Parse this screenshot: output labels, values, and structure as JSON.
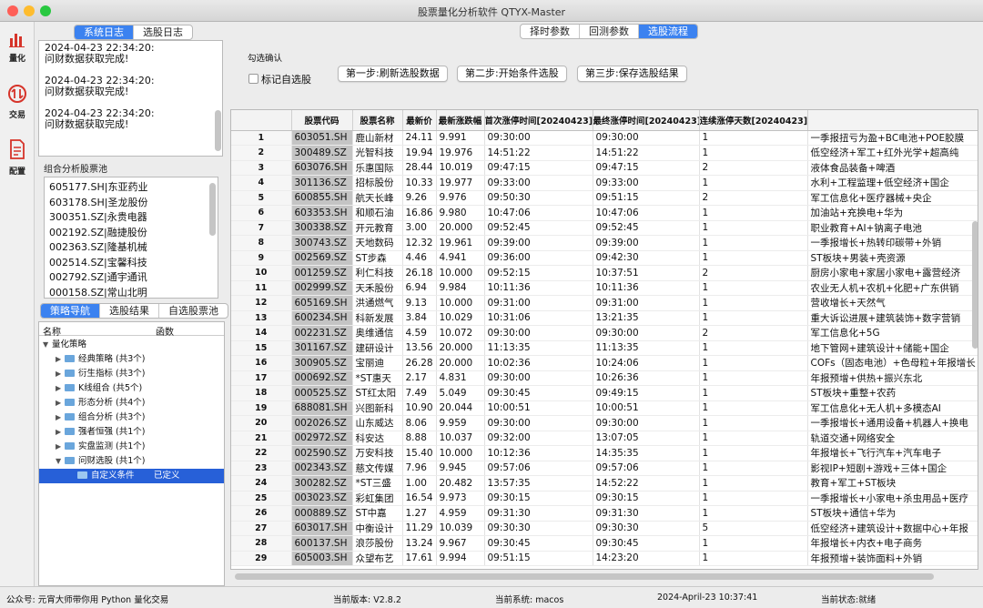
{
  "window": {
    "title": "股票量化分析软件 QTYX-Master"
  },
  "sidebar": {
    "items": [
      {
        "label": "量化",
        "icon": "bar-chart-icon"
      },
      {
        "label": "交易",
        "icon": "exchange-icon"
      },
      {
        "label": "配置",
        "icon": "document-icon"
      }
    ]
  },
  "left_tabs": {
    "tab1": "系统日志",
    "tab2": "选股日志"
  },
  "log": {
    "entries": [
      {
        "time": "2024-04-23 22:34:20:",
        "msg": "问财数据获取完成!"
      },
      {
        "time": "2024-04-23 22:34:20:",
        "msg": "问财数据获取完成!"
      },
      {
        "time": "2024-04-23 22:34:20:",
        "msg": "问财数据获取完成!"
      }
    ]
  },
  "pool": {
    "caption": "组合分析股票池",
    "items": [
      "605177.SH|东亚药业",
      "603178.SH|圣龙股份",
      "300351.SZ|永贵电器",
      "002192.SZ|融捷股份",
      "002363.SZ|隆基机械",
      "002514.SZ|宝馨科技",
      "002792.SZ|通宇通讯",
      "000158.SZ|常山北明"
    ]
  },
  "strategy_tabs": {
    "tab1": "策略导航",
    "tab2": "选股结果",
    "tab3": "自选股票池"
  },
  "tree": {
    "col_name": "名称",
    "col_func": "函数",
    "root": "量化策略",
    "nodes": [
      "经典策略 (共3个)",
      "衍生指标 (共3个)",
      "K线组合 (共5个)",
      "形态分析 (共4个)",
      "组合分析 (共3个)",
      "强者恒强 (共1个)",
      "实盘监测 (共1个)",
      "问财选股 (共1个)"
    ],
    "selected_name": "自定义条件",
    "selected_func": "已定义"
  },
  "top_tabs": {
    "tab1": "择时参数",
    "tab2": "回测参数",
    "tab3": "选股流程"
  },
  "controls": {
    "group_label": "勾选确认",
    "checkbox_label": "标记自选股",
    "step1": "第一步:刷新选股数据",
    "step2": "第二步:开始条件选股",
    "step3": "第三步:保存选股结果"
  },
  "table": {
    "headers": [
      "",
      "股票代码",
      "股票名称",
      "最新价",
      "最新涨跌幅",
      "首次涨停时间[20240423]",
      "最终涨停时间[20240423]",
      "连续涨停天数[20240423]",
      "涨停原因类别[20240"
    ],
    "rows": [
      [
        "1",
        "603051.SH",
        "鹿山新材",
        "24.11",
        "9.991",
        "09:30:00",
        "09:30:00",
        "1",
        "一季报扭亏为盈+BC电池+POE胶膜"
      ],
      [
        "2",
        "300489.SZ",
        "光智科技",
        "19.94",
        "19.976",
        "14:51:22",
        "14:51:22",
        "1",
        "低空经济+军工+红外光学+超高纯"
      ],
      [
        "3",
        "603076.SH",
        "乐惠国际",
        "28.44",
        "10.019",
        "09:47:15",
        "09:47:15",
        "2",
        "液体食品装备+啤酒"
      ],
      [
        "4",
        "301136.SZ",
        "招标股份",
        "10.33",
        "19.977",
        "09:33:00",
        "09:33:00",
        "1",
        "水利+工程监理+低空经济+国企"
      ],
      [
        "5",
        "600855.SH",
        "航天长峰",
        "9.26",
        "9.976",
        "09:50:30",
        "09:51:15",
        "2",
        "军工信息化+医疗器械+央企"
      ],
      [
        "6",
        "603353.SH",
        "和顺石油",
        "16.86",
        "9.980",
        "10:47:06",
        "10:47:06",
        "1",
        "加油站+充换电+华为"
      ],
      [
        "7",
        "300338.SZ",
        "开元教育",
        "3.00",
        "20.000",
        "09:52:45",
        "09:52:45",
        "1",
        "职业教育+AI+钠离子电池"
      ],
      [
        "8",
        "300743.SZ",
        "天地数码",
        "12.32",
        "19.961",
        "09:39:00",
        "09:39:00",
        "1",
        "一季报增长+热转印碳带+外销"
      ],
      [
        "9",
        "002569.SZ",
        "ST步森",
        "4.46",
        "4.941",
        "09:36:00",
        "09:42:30",
        "1",
        "ST板块+男装+壳资源"
      ],
      [
        "10",
        "001259.SZ",
        "利仁科技",
        "26.18",
        "10.000",
        "09:52:15",
        "10:37:51",
        "2",
        "厨房小家电+家居小家电+露营经济"
      ],
      [
        "11",
        "002999.SZ",
        "天禾股份",
        "6.94",
        "9.984",
        "10:11:36",
        "10:11:36",
        "1",
        "农业无人机+农机+化肥+广东供销"
      ],
      [
        "12",
        "605169.SH",
        "洪通燃气",
        "9.13",
        "10.000",
        "09:31:00",
        "09:31:00",
        "1",
        "营收增长+天然气"
      ],
      [
        "13",
        "600234.SH",
        "科新发展",
        "3.84",
        "10.029",
        "10:31:06",
        "13:21:35",
        "1",
        "重大诉讼进展+建筑装饰+数字营销"
      ],
      [
        "14",
        "002231.SZ",
        "奥维通信",
        "4.59",
        "10.072",
        "09:30:00",
        "09:30:00",
        "2",
        "军工信息化+5G"
      ],
      [
        "15",
        "301167.SZ",
        "建研设计",
        "13.56",
        "20.000",
        "11:13:35",
        "11:13:35",
        "1",
        "地下管网+建筑设计+储能+国企"
      ],
      [
        "16",
        "300905.SZ",
        "宝丽迪",
        "26.28",
        "20.000",
        "10:02:36",
        "10:24:06",
        "1",
        "COFs（固态电池）+色母粒+年报增长"
      ],
      [
        "17",
        "000692.SZ",
        "*ST惠天",
        "2.17",
        "4.831",
        "09:30:00",
        "10:26:36",
        "1",
        "年报预增+供热+振兴东北"
      ],
      [
        "18",
        "000525.SZ",
        "ST红太阳",
        "7.49",
        "5.049",
        "09:30:45",
        "09:49:15",
        "1",
        "ST板块+重整+农药"
      ],
      [
        "19",
        "688081.SH",
        "兴图新科",
        "10.90",
        "20.044",
        "10:00:51",
        "10:00:51",
        "1",
        "军工信息化+无人机+多模态AI"
      ],
      [
        "20",
        "002026.SZ",
        "山东威达",
        "8.06",
        "9.959",
        "09:30:00",
        "09:30:00",
        "1",
        "一季报增长+通用设备+机器人+换电"
      ],
      [
        "21",
        "002972.SZ",
        "科安达",
        "8.88",
        "10.037",
        "09:32:00",
        "13:07:05",
        "1",
        "轨道交通+网络安全"
      ],
      [
        "22",
        "002590.SZ",
        "万安科技",
        "15.40",
        "10.000",
        "10:12:36",
        "14:35:35",
        "1",
        "年报增长+飞行汽车+汽车电子"
      ],
      [
        "23",
        "002343.SZ",
        "慈文传媒",
        "7.96",
        "9.945",
        "09:57:06",
        "09:57:06",
        "1",
        "影视IP+短剧+游戏+三体+国企"
      ],
      [
        "24",
        "300282.SZ",
        "*ST三盛",
        "1.00",
        "20.482",
        "13:57:35",
        "14:52:22",
        "1",
        "教育+军工+ST板块"
      ],
      [
        "25",
        "003023.SZ",
        "彩虹集团",
        "16.54",
        "9.973",
        "09:30:15",
        "09:30:15",
        "1",
        "一季报增长+小家电+杀虫用品+医疗"
      ],
      [
        "26",
        "000889.SZ",
        "ST中嘉",
        "1.27",
        "4.959",
        "09:31:30",
        "09:31:30",
        "1",
        "ST板块+通信+华为"
      ],
      [
        "27",
        "603017.SH",
        "中衡设计",
        "11.29",
        "10.039",
        "09:30:30",
        "09:30:30",
        "5",
        "低空经济+建筑设计+数据中心+年报"
      ],
      [
        "28",
        "600137.SH",
        "浪莎股份",
        "13.24",
        "9.967",
        "09:30:45",
        "09:30:45",
        "1",
        "年报增长+内衣+电子商务"
      ],
      [
        "29",
        "605003.SH",
        "众望布艺",
        "17.61",
        "9.994",
        "09:51:15",
        "14:23:20",
        "1",
        "年报预增+装饰面料+外销"
      ]
    ]
  },
  "status": {
    "account": "公众号: 元宵大师带你用 Python 量化交易",
    "version": "当前版本: V2.8.2",
    "system": "当前系统: macos",
    "datetime": "2024-April-23 10:37:41",
    "state": "当前状态:就绪"
  },
  "colors": {
    "accent": "#3b82f0",
    "selected_row": "#2760d8",
    "code_cell": "#c4c4c4"
  }
}
